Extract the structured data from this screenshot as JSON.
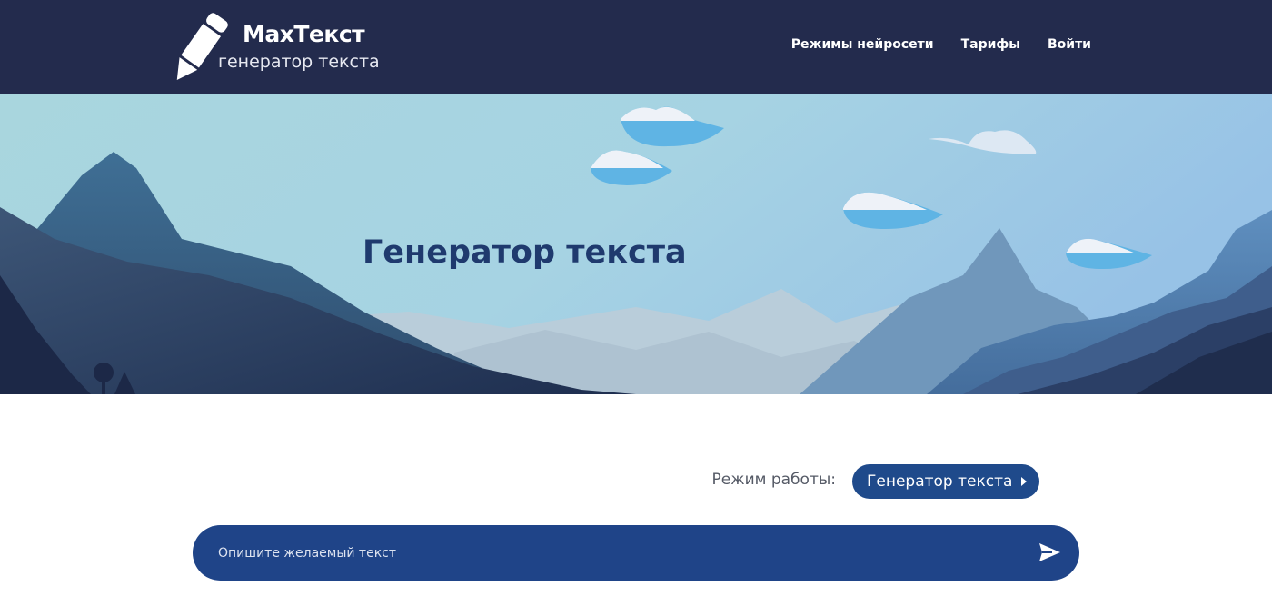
{
  "header": {
    "logo_title": "MaxТекст",
    "logo_subtitle": "генератор текста",
    "logo_icon": "pencil-icon",
    "nav": [
      {
        "label": "Режимы нейросети"
      },
      {
        "label": "Тарифы"
      },
      {
        "label": "Войти"
      }
    ]
  },
  "hero": {
    "title": "Генератор текста"
  },
  "mode": {
    "label": "Режим работы:",
    "value": "Генератор текста",
    "icon": "caret-right-icon"
  },
  "prompt": {
    "placeholder": "Опишите желаемый текст",
    "send_icon": "send-icon"
  },
  "colors": {
    "header_bg": "#232b4d",
    "accent": "#1f4488",
    "hero_title": "#1f3a6e"
  }
}
